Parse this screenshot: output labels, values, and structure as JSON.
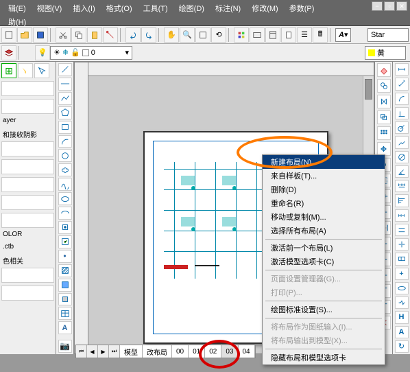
{
  "menus": {
    "edit": "辑(E)",
    "view": "视图(V)",
    "insert": "插入(I)",
    "format": "格式(O)",
    "tools": "工具(T)",
    "draw": "绘图(D)",
    "dim": "标注(N)",
    "modify": "修改(M)",
    "params": "参数(P)",
    "help": "助(H)"
  },
  "toolbar": {
    "standard_label": "Star",
    "layer_value": "0",
    "color_name": "黄"
  },
  "props": {
    "layer_lbl": "ayer",
    "shadow": "和接收阴影",
    "color_lbl": "OLOR",
    "ctb": ".ctb",
    "related": "色相关"
  },
  "tabs": {
    "model": "模型",
    "layout1": "改布局",
    "t00": "00",
    "t01": "01",
    "t02": "02",
    "t03": "03",
    "t04": "04"
  },
  "ctx": {
    "new_layout": "新建布局(N)",
    "from_template": "来自样板(T)...",
    "delete": "删除(D)",
    "rename": "重命名(R)",
    "move_copy": "移动或复制(M)...",
    "select_all": "选择所有布局(A)",
    "activate_prev": "激活前一个布局(L)",
    "activate_model": "激活模型选项卡(C)",
    "page_setup": "页面设置管理器(G)...",
    "print": "打印(P)...",
    "draft_setup": "绘图标准设置(S)...",
    "layout_as_image": "将布局作为图纸输入(I)...",
    "layout_to_model": "将布局输出到模型(X)...",
    "hide_tabs": "隐藏布局和模型选项卡"
  },
  "icons": {
    "new": "new",
    "open": "open",
    "save": "save",
    "cut": "cut",
    "copy": "copy",
    "paste": "paste",
    "undo": "undo",
    "redo": "redo"
  }
}
